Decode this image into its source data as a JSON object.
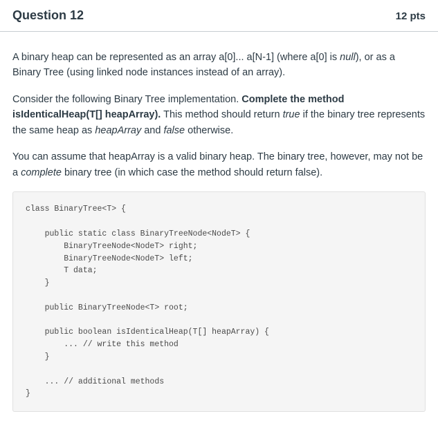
{
  "header": {
    "title": "Question 12",
    "points": "12 pts"
  },
  "body": {
    "para1_prefix": "A binary heap can be represented as an array a[0]... a[N-1] (where a[0] is ",
    "para1_null": "null",
    "para1_suffix": "), or as a Binary Tree (using linked node instances instead of an array).",
    "para2_prefix": "Consider the following Binary Tree implementation. ",
    "para2_bold": "Complete the method isIdenticalHeap(T[] heapArray).",
    "para2_mid1": " This method should return ",
    "para2_true": "true",
    "para2_mid2": " if the binary tree represents the same heap as ",
    "para2_heaparray": "heapArray",
    "para2_mid3": " and ",
    "para2_false": "false",
    "para2_suffix": " otherwise.",
    "para3_prefix": "You can assume that heapArray is a valid binary heap. The binary tree, however, may not be a ",
    "para3_complete": "complete",
    "para3_suffix": " binary tree (in which case the method should return false)."
  },
  "code": "class BinaryTree<T> {\n\n    public static class BinaryTreeNode<NodeT> {\n        BinaryTreeNode<NodeT> right;\n        BinaryTreeNode<NodeT> left;\n        T data;\n    }\n\n    public BinaryTreeNode<T> root;\n\n    public boolean isIdenticalHeap(T[] heapArray) {\n        ... // write this method\n    }\n\n    ... // additional methods\n}"
}
